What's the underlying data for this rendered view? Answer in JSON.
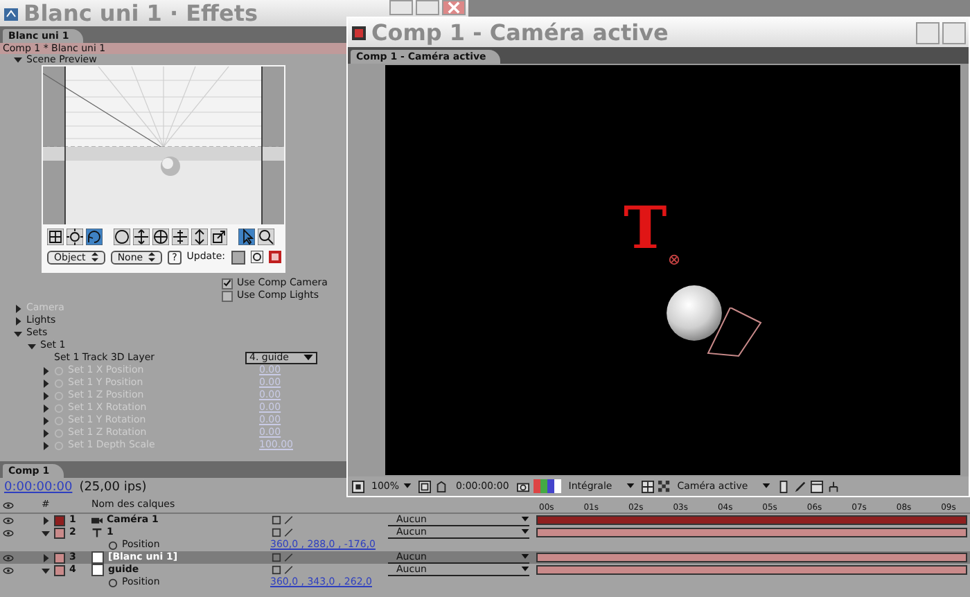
{
  "effects_window": {
    "title": "Blanc uni 1 · Effets",
    "tab": "Blanc uni 1",
    "breadcrumb": "Comp 1 * Blanc uni 1",
    "section": {
      "label": "Scene Preview",
      "expanded": true
    },
    "preview_tools": [
      {
        "kind": "grid",
        "selected": false
      },
      {
        "kind": "light",
        "selected": false
      },
      {
        "kind": "rotate",
        "selected": true
      },
      {
        "kind": "sphere",
        "selected": false
      },
      {
        "kind": "move",
        "selected": false
      },
      {
        "kind": "orbit",
        "selected": false
      },
      {
        "kind": "pan",
        "selected": false
      },
      {
        "kind": "dolly",
        "selected": false
      },
      {
        "kind": "scale",
        "selected": false
      },
      {
        "kind": "pointer",
        "selected": true
      },
      {
        "kind": "zoom",
        "selected": false
      }
    ],
    "object_menu": "Object",
    "light_menu": "None",
    "help_button": "?",
    "update_label": "Update:",
    "options": [
      {
        "label": "Use Comp Camera",
        "checked": true
      },
      {
        "label": "Use Comp Lights",
        "checked": false
      }
    ],
    "tree": [
      {
        "label": "Camera",
        "expanded": false,
        "disabled": true
      },
      {
        "label": "Lights",
        "expanded": false,
        "disabled": false
      },
      {
        "label": "Sets",
        "expanded": true,
        "disabled": false,
        "children": [
          {
            "label": "Set 1",
            "expanded": true,
            "disabled": false,
            "children": [
              {
                "kind": "menu",
                "label": "Set 1 Track 3D Layer",
                "value": "4. guide",
                "disabled": false
              },
              {
                "kind": "value",
                "label": "Set 1 X Position",
                "value": "0.00",
                "disabled": true
              },
              {
                "kind": "value",
                "label": "Set 1 Y Position",
                "value": "0.00",
                "disabled": true
              },
              {
                "kind": "value",
                "label": "Set 1 Z Position",
                "value": "0.00",
                "disabled": true
              },
              {
                "kind": "value",
                "label": "Set 1 X Rotation",
                "value": "0.00",
                "disabled": true
              },
              {
                "kind": "value",
                "label": "Set 1 Y Rotation",
                "value": "0.00",
                "disabled": true
              },
              {
                "kind": "value",
                "label": "Set 1 Z Rotation",
                "value": "0.00",
                "disabled": true
              },
              {
                "kind": "value",
                "label": "Set 1 Depth Scale",
                "value": "100.00",
                "disabled": true
              }
            ]
          }
        ]
      }
    ]
  },
  "comp_window": {
    "title": "Comp 1 - Caméra active",
    "tab": "Comp 1 - Caméra active",
    "text_layer": "T",
    "toolbar": {
      "zoom": "100%",
      "time": "0:00:00:00",
      "resolution": "Intégrale",
      "view": "Caméra active"
    }
  },
  "timeline": {
    "tab": "Comp 1",
    "time": "0:00:00:00",
    "fps": "(25,00 ips)",
    "number_column": "#",
    "name_column": "Nom des calques",
    "ruler": [
      "00s",
      "01s",
      "02s",
      "03s",
      "04s",
      "05s",
      "06s",
      "07s",
      "08s",
      "09s"
    ],
    "layers": [
      {
        "number": "1",
        "name": "Caméra 1",
        "kind": "camera",
        "expanded": false,
        "selected": false,
        "parent": "Aucun",
        "color": "#8e1f1f"
      },
      {
        "number": "2",
        "name": "1",
        "kind": "text",
        "expanded": true,
        "selected": false,
        "parent": "Aucun",
        "color": "#c98a8a",
        "properties": [
          {
            "label": "Position",
            "value": "360,0 , 288,0 , -176,0"
          }
        ]
      },
      {
        "number": "3",
        "name": "[Blanc uni 1]",
        "kind": "solid",
        "expanded": false,
        "selected": true,
        "parent": "Aucun",
        "color": "#c98a8a"
      },
      {
        "number": "4",
        "name": "guide",
        "kind": "solid",
        "expanded": true,
        "selected": false,
        "parent": "Aucun",
        "color": "#c98a8a",
        "properties": [
          {
            "label": "Position",
            "value": "360,0 , 343,0 , 262,0"
          }
        ]
      }
    ]
  }
}
